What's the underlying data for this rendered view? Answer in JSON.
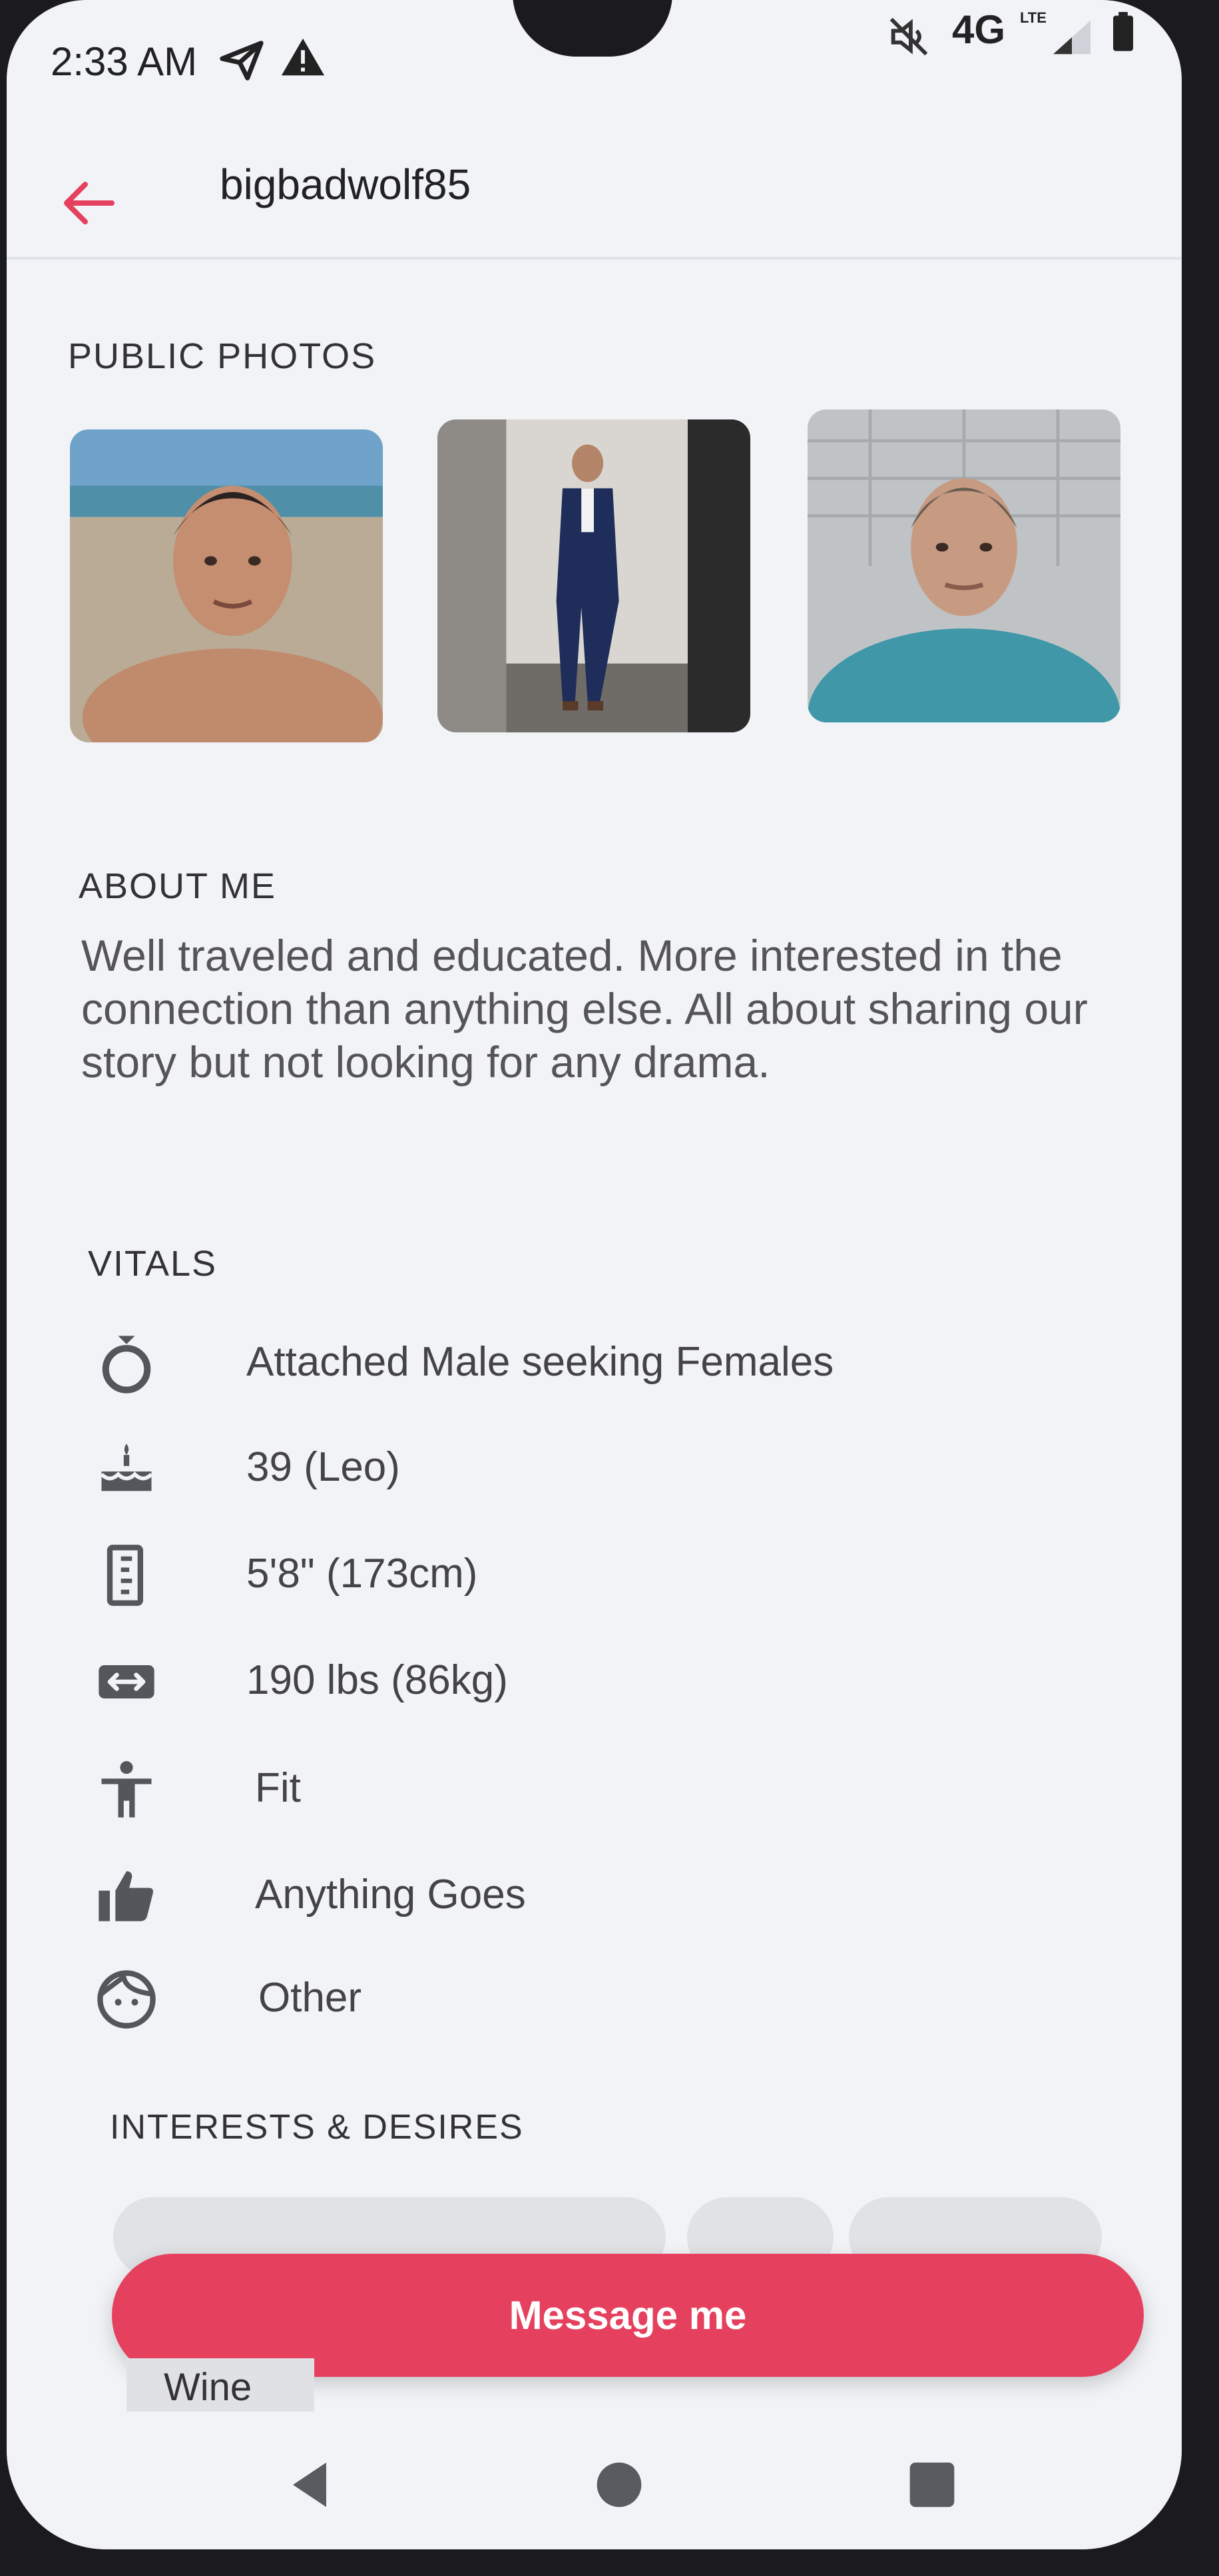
{
  "status_bar": {
    "time": "2:33 AM",
    "network": "4G",
    "network_sub": "LTE",
    "icons": [
      "telegram-send-icon",
      "warning-icon",
      "mute-icon",
      "signal-icon",
      "battery-icon"
    ]
  },
  "app_bar": {
    "title": "bigbadwolf85",
    "back_icon": "arrow-left-icon"
  },
  "public_photos": {
    "title": "PUBLIC PHOTOS"
  },
  "about": {
    "title": "ABOUT ME",
    "text": "Well traveled and educated. More interested in the connection than anything else. All about sharing our story but not looking for any drama."
  },
  "vitals": {
    "title": "VITALS",
    "items": [
      {
        "icon": "ring-icon",
        "text": "Attached Male seeking Females"
      },
      {
        "icon": "cake-icon",
        "text": "39 (Leo)"
      },
      {
        "icon": "ruler-icon",
        "text": "5'8\" (173cm)"
      },
      {
        "icon": "width-arrows-icon",
        "text": "190 lbs (86kg)"
      },
      {
        "icon": "person-icon",
        "text": "Fit"
      },
      {
        "icon": "thumbs-up-icon",
        "text": "Anything Goes"
      },
      {
        "icon": "face-icon",
        "text": "Other"
      }
    ]
  },
  "interests": {
    "title": "INTERESTS & DESIRES",
    "partial_chip": "Wine"
  },
  "cta": {
    "label": "Message me"
  },
  "colors": {
    "accent": "#e5415f",
    "background": "#f1f3f7",
    "text_primary": "#222222",
    "text_secondary": "#555555"
  }
}
